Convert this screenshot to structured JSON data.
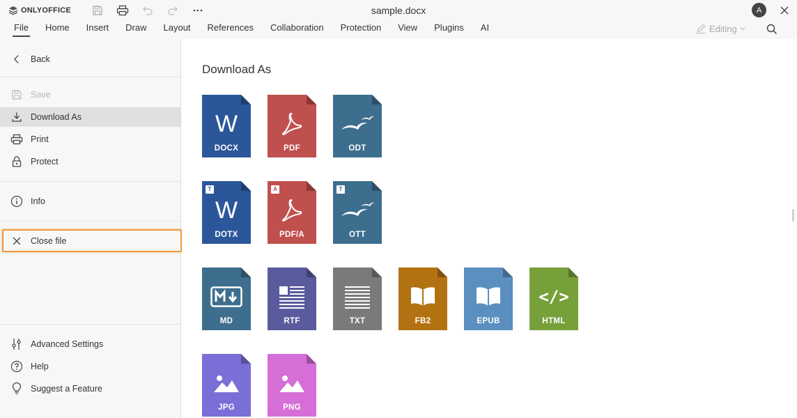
{
  "app": {
    "logo_text": "ONLYOFFICE",
    "document_title": "sample.docx",
    "user_initial": "A"
  },
  "tabs": [
    "File",
    "Home",
    "Insert",
    "Draw",
    "Layout",
    "References",
    "Collaboration",
    "Protection",
    "View",
    "Plugins",
    "AI"
  ],
  "active_tab": "File",
  "mode": {
    "label": "Editing"
  },
  "menu": {
    "back": "Back",
    "save": "Save",
    "download_as": "Download As",
    "print": "Print",
    "protect": "Protect",
    "info": "Info",
    "close_file": "Close file",
    "advanced_settings": "Advanced Settings",
    "help": "Help",
    "suggest_feature": "Suggest a Feature"
  },
  "main": {
    "title": "Download As",
    "formats": [
      {
        "name": "DOCX",
        "color": "#2b579a",
        "glyph": "W"
      },
      {
        "name": "PDF",
        "color": "#c0504d",
        "glyph": "pdf"
      },
      {
        "name": "ODT",
        "color": "#3e6e8e",
        "glyph": "gulls"
      },
      {
        "name": "DOTX",
        "color": "#2b579a",
        "glyph": "W",
        "badge": "T"
      },
      {
        "name": "PDF/A",
        "color": "#c0504d",
        "glyph": "pdf",
        "badge": "A"
      },
      {
        "name": "OTT",
        "color": "#3e6e8e",
        "glyph": "gulls",
        "badge": "T"
      },
      {
        "name": "MD",
        "color": "#3e6e8e",
        "glyph": "md"
      },
      {
        "name": "RTF",
        "color": "#5a5a9e",
        "glyph": "rtf"
      },
      {
        "name": "TXT",
        "color": "#7a7a7a",
        "glyph": "txt"
      },
      {
        "name": "FB2",
        "color": "#b37212",
        "glyph": "book"
      },
      {
        "name": "EPUB",
        "color": "#5a8fc0",
        "glyph": "book"
      },
      {
        "name": "HTML",
        "color": "#77a03a",
        "glyph": "html"
      },
      {
        "name": "JPG",
        "color": "#7a6fd6",
        "glyph": "image"
      },
      {
        "name": "PNG",
        "color": "#d56ed6",
        "glyph": "image"
      }
    ]
  },
  "colors": {
    "highlight": "#f0963c",
    "menu_bg": "#f7f7f7",
    "selected_bg": "#e0e0e0"
  }
}
